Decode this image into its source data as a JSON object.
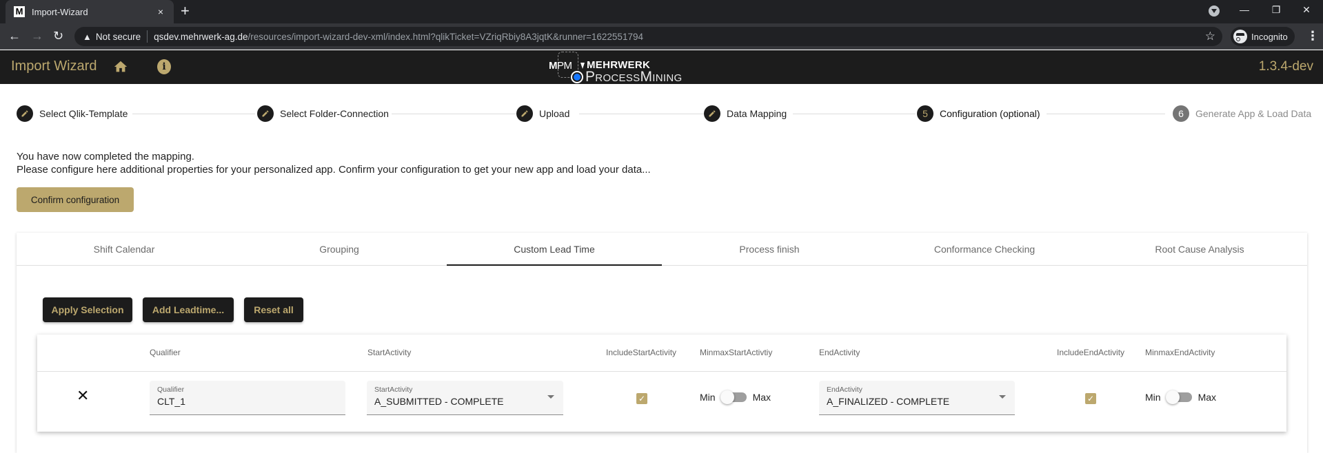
{
  "browser": {
    "tab_title": "Import-Wizard",
    "tab_favicon": "M",
    "tab_close": "×",
    "new_tab": "+",
    "security_label": "Not secure",
    "url_host": "qsdev.mehrwerk-ag.de",
    "url_path": "/resources/import-wizard-dev-xml/index.html?qlikTicket=VZriqRbiy8A3jqtK&runner=1622551794",
    "profile_label": "Incognito",
    "icons": {
      "back": "←",
      "forward": "→",
      "reload": "↻",
      "warning": "▲",
      "bookmark": "☆",
      "menu": "⋮",
      "minimize": "—",
      "restore": "❐",
      "close": "✕"
    }
  },
  "header": {
    "title": "Import Wizard",
    "info_glyph": "i",
    "logo": {
      "mpm_m": "M",
      "mpm_pm": "PM",
      "brand": "MEHRWERK",
      "product": "ProcessMining"
    },
    "version": "1.3.4-dev"
  },
  "stepper": {
    "steps": [
      {
        "label": "Select Qlik-Template",
        "state": "done",
        "icon": "pencil-icon"
      },
      {
        "label": "Select Folder-Connection",
        "state": "done",
        "icon": "pencil-icon"
      },
      {
        "label": "Upload",
        "state": "done",
        "icon": "pencil-icon"
      },
      {
        "label": "Data Mapping",
        "state": "done",
        "icon": "pencil-icon"
      },
      {
        "label": "Configuration (optional)",
        "state": "active",
        "number": "5"
      },
      {
        "label": "Generate App & Load Data",
        "state": "pending",
        "number": "6"
      }
    ]
  },
  "intro": {
    "line1": "You have now completed the mapping.",
    "line2": "Please configure here additional properties for your personalized app. Confirm your configuration to get your new app and load your data...",
    "confirm_label": "Confirm configuration"
  },
  "config_tabs": {
    "items": [
      {
        "label": "Shift Calendar"
      },
      {
        "label": "Grouping"
      },
      {
        "label": "Custom Lead Time",
        "active": true
      },
      {
        "label": "Process finish"
      },
      {
        "label": "Conformance Checking"
      },
      {
        "label": "Root Cause Analysis"
      }
    ]
  },
  "lead_time": {
    "actions": {
      "apply": "Apply Selection",
      "add": "Add Leadtime...",
      "reset": "Reset all"
    },
    "columns": [
      "Qualifier",
      "StartActivity",
      "IncludeStartActivity",
      "MinmaxStartActivtiy",
      "EndActivity",
      "IncludeEndActivity",
      "MinmaxEndActivity"
    ],
    "rows": [
      {
        "delete_glyph": "✕",
        "qualifier_label": "Qualifier",
        "qualifier": "CLT_1",
        "start_label": "StartActivity",
        "start_activity": "A_SUBMITTED - COMPLETE",
        "include_start": true,
        "minmax_start": {
          "left": "Min",
          "right": "Max",
          "value": "Min"
        },
        "end_label": "EndActivity",
        "end_activity": "A_FINALIZED - COMPLETE",
        "include_end": true,
        "minmax_end": {
          "left": "Min",
          "right": "Max",
          "value": "Min"
        },
        "check_glyph": "✓"
      }
    ]
  },
  "colors": {
    "accent_gold": "#bca86e",
    "header_dark": "#1c1c1c",
    "logo_blue": "#1677ff"
  }
}
